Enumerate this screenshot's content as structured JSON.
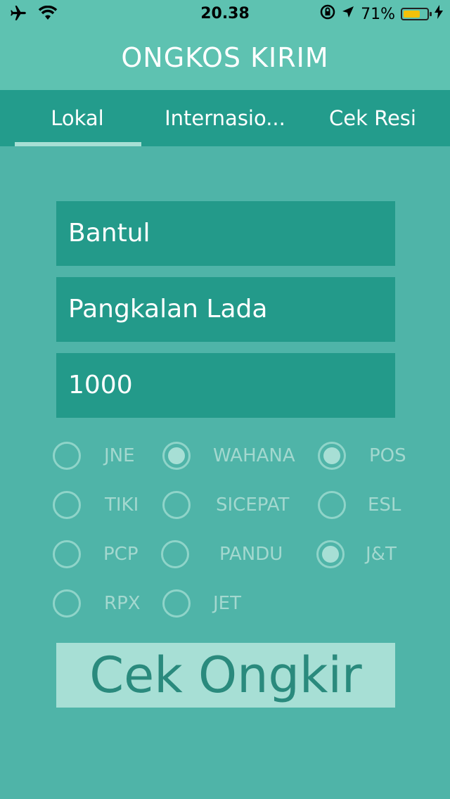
{
  "status_bar": {
    "time": "20.38",
    "battery": "71%",
    "battery_level": 0.71,
    "icons": [
      "airplane-icon",
      "wifi-icon",
      "orientation-lock-icon",
      "location-arrow-icon",
      "battery-icon",
      "charging-bolt-icon"
    ]
  },
  "header": {
    "title": "ONGKOS KIRIM"
  },
  "tabs": [
    {
      "label": "Lokal",
      "active": true
    },
    {
      "label": "Internasio..."
    },
    {
      "label": "Cek Resi"
    }
  ],
  "form": {
    "origin": "Bantul",
    "destination": "Pangkalan Lada",
    "weight": "1000"
  },
  "couriers": [
    {
      "label": "JNE",
      "selected": false
    },
    {
      "label": "WAHANA",
      "selected": true
    },
    {
      "label": "POS",
      "selected": true
    },
    {
      "label": "TIKI",
      "selected": false
    },
    {
      "label": "SICEPAT",
      "selected": false
    },
    {
      "label": "ESL",
      "selected": false
    },
    {
      "label": "PCP",
      "selected": false
    },
    {
      "label": "PANDU",
      "selected": false
    },
    {
      "label": "J&T",
      "selected": true
    },
    {
      "label": "RPX",
      "selected": false
    },
    {
      "label": "JET",
      "selected": false
    }
  ],
  "submit_label": "Cek Ongkir",
  "colors": {
    "background": "#4fb4a8",
    "header": "#5ec2b1",
    "tabs": "#239c8c",
    "button": "#a7dfd5"
  }
}
